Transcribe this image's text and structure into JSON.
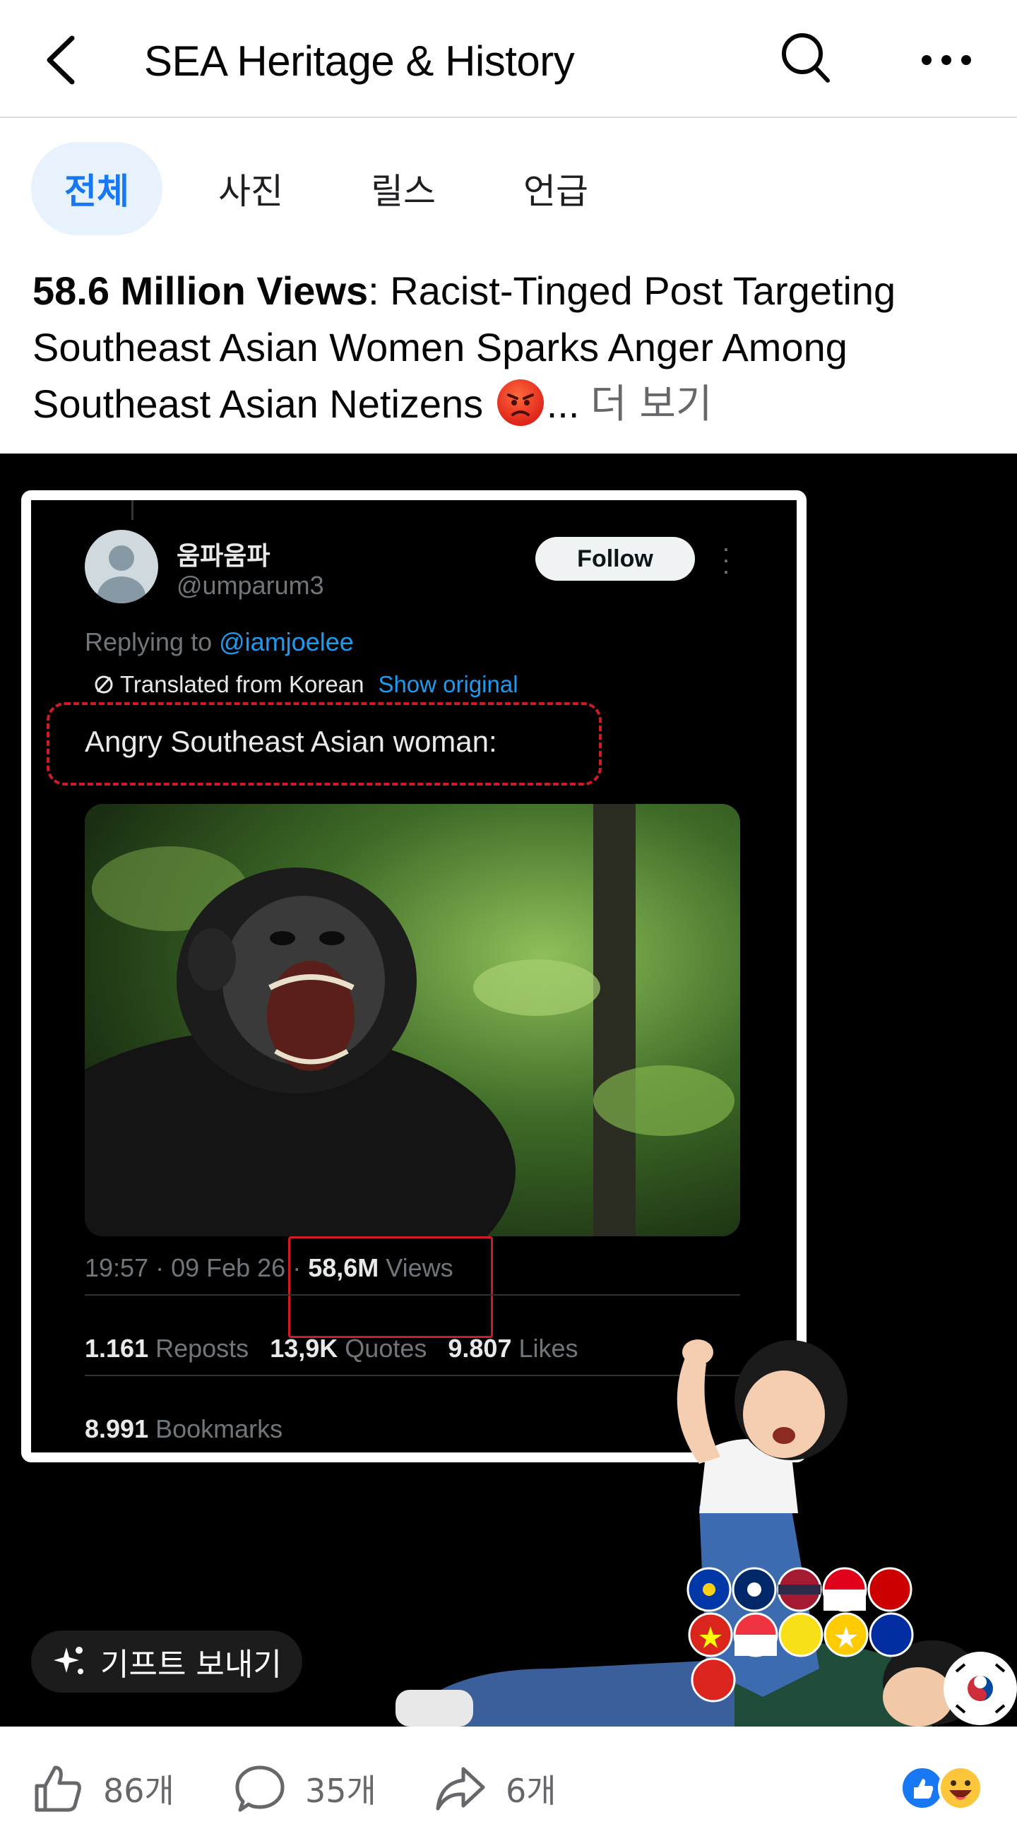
{
  "header": {
    "title": "SEA Heritage & History"
  },
  "tabs": [
    {
      "label": "전체",
      "active": true
    },
    {
      "label": "사진",
      "active": false
    },
    {
      "label": "릴스",
      "active": false
    },
    {
      "label": "언급",
      "active": false
    }
  ],
  "post": {
    "caption_bold": "58.6 Million Views",
    "caption_rest": ": Racist-Tinged Post Targeting Southeast Asian Women Sparks Anger Among Southeast Asian Netizens",
    "ellipsis": "...",
    "see_more": "더 보기"
  },
  "tweet": {
    "display_name": "움파움파",
    "handle": "@umparum3",
    "follow_label": "Follow",
    "replying_prefix": "Replying to",
    "replying_to": "@iamjoelee",
    "translated_label": "Translated from Korean",
    "show_original": "Show original",
    "text": "Angry Southeast Asian woman:",
    "time": "19:57 · 09 Feb 26 ·",
    "views_count": "58,6M",
    "views_label": "Views",
    "reposts_count": "1.161",
    "reposts_label": "Reposts",
    "quotes_count": "13,9K",
    "quotes_label": "Quotes",
    "likes_count": "9.807",
    "likes_label": "Likes",
    "bookmarks_count": "8.991",
    "bookmarks_label": "Bookmarks"
  },
  "gift_button": {
    "label": "기프트 보내기"
  },
  "footer": {
    "like_count": "86개",
    "comment_count": "35개",
    "share_count": "6개"
  },
  "colors": {
    "accent": "#1877f2",
    "tab_active_bg": "#e7f2fd",
    "link_blue": "#1d9bf0",
    "highlight_red": "#d01b26"
  },
  "icons": {
    "back": "chevron-left-icon",
    "search": "search-icon",
    "more": "more-horizontal-icon",
    "like": "thumbs-up-icon",
    "comment": "comment-bubble-icon",
    "share": "share-arrow-icon",
    "gift": "gift-sparkle-icon"
  }
}
